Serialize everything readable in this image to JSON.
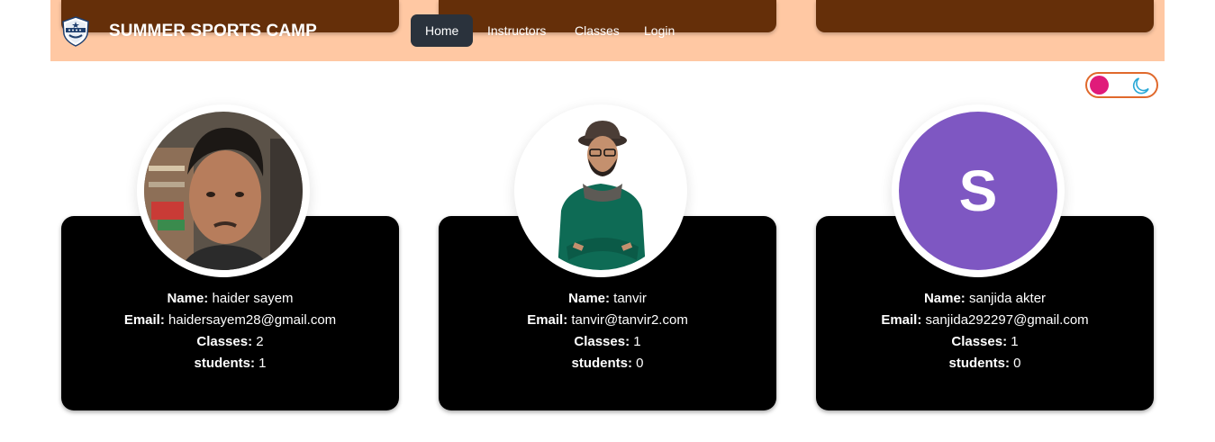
{
  "header": {
    "brand": "SUMMER SPORTS CAMP",
    "logo_icon": "shield-logo-icon",
    "nav": [
      {
        "label": "Home",
        "active": true
      },
      {
        "label": "Instructors",
        "active": false
      },
      {
        "label": "Classes",
        "active": false
      },
      {
        "label": "Login",
        "active": false
      }
    ]
  },
  "theme_toggle": {
    "icon": "moon-icon",
    "knob_color": "#e01b7a",
    "border_color": "#e0692c"
  },
  "colors": {
    "nav_bg": "#ffc8a3",
    "top_card": "#652f09",
    "card_bg": "#000000",
    "active_nav": "#2a323c"
  },
  "field_labels": {
    "name": "Name:",
    "email": "Email:",
    "classes": "Classes:",
    "students": "students:"
  },
  "instructors": [
    {
      "name": "haider sayem",
      "email": "haidersayem28@gmail.com",
      "classes": "2",
      "students": "1",
      "avatar": "photo"
    },
    {
      "name": "tanvir",
      "email": "tanvir@tanvir2.com",
      "classes": "1",
      "students": "0",
      "avatar": "photo"
    },
    {
      "name": "sanjida akter",
      "email": "sanjida292297@gmail.com",
      "classes": "1",
      "students": "0",
      "avatar": "letter",
      "avatar_letter": "S",
      "avatar_color": "#7e57c2"
    }
  ]
}
